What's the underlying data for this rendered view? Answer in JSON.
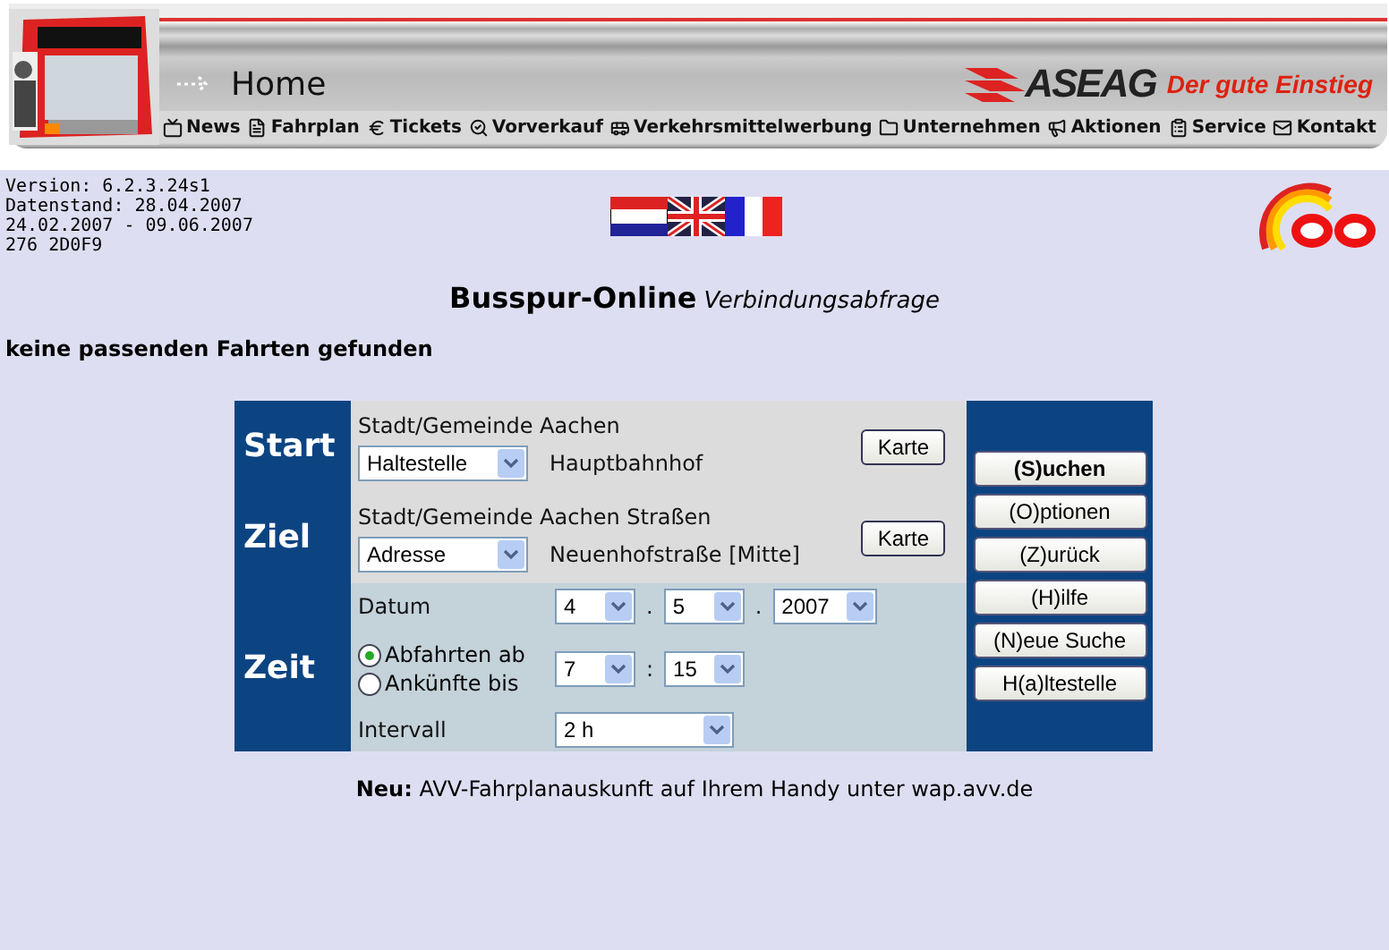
{
  "header": {
    "title": "Home",
    "brand": "ASEAG",
    "slogan": "Der gute Einstieg",
    "nav": [
      {
        "label": "News"
      },
      {
        "label": "Fahrplan"
      },
      {
        "label": "Tickets"
      },
      {
        "label": "Vorverkauf"
      },
      {
        "label": "Verkehrsmittelwerbung"
      },
      {
        "label": "Unternehmen"
      },
      {
        "label": "Aktionen"
      },
      {
        "label": "Service"
      },
      {
        "label": "Kontakt"
      }
    ]
  },
  "info_lines": [
    "Version: 6.2.3.24s1",
    "Datenstand: 28.04.2007",
    "24.02.2007 - 09.06.2007",
    "276 2D0F9"
  ],
  "heading": {
    "title": "Busspur-Online",
    "subtitle": "Verbindungsabfrage"
  },
  "message": "keine passenden Fahrten gefunden",
  "form": {
    "start": {
      "label": "Start",
      "place": "Stadt/Gemeinde Aachen",
      "type": "Haltestelle",
      "name": "Hauptbahnhof",
      "map_button": "Karte"
    },
    "ziel": {
      "label": "Ziel",
      "place": "Stadt/Gemeinde Aachen Straßen",
      "type": "Adresse",
      "name": "Neuenhofstraße [Mitte]",
      "map_button": "Karte"
    },
    "zeit": {
      "label": "Zeit",
      "date_label": "Datum",
      "day": "4",
      "month": "5",
      "year": "2007",
      "date_separator": ".",
      "hour": "7",
      "minute": "15",
      "time_separator": ":",
      "interval_label": "Intervall",
      "interval": "2 h",
      "modes": [
        {
          "label": "Abfahrten ab",
          "selected": true
        },
        {
          "label": "Ankünfte bis",
          "selected": false
        }
      ]
    },
    "buttons": [
      {
        "label": "(S)uchen",
        "kind": "primary"
      },
      {
        "label": "(O)ptionen",
        "kind": "normal"
      },
      {
        "label": "(Z)urück",
        "kind": "normal"
      },
      {
        "label": "(H)ilfe",
        "kind": "normal"
      },
      {
        "label": "(N)eue Suche",
        "kind": "normal"
      },
      {
        "label": "H(a)ltestelle",
        "kind": "normal"
      }
    ]
  },
  "footer_note": "**Neu:** AVV-Fahrplanauskunft auf Ihrem Handy unter wap.avv.de"
}
